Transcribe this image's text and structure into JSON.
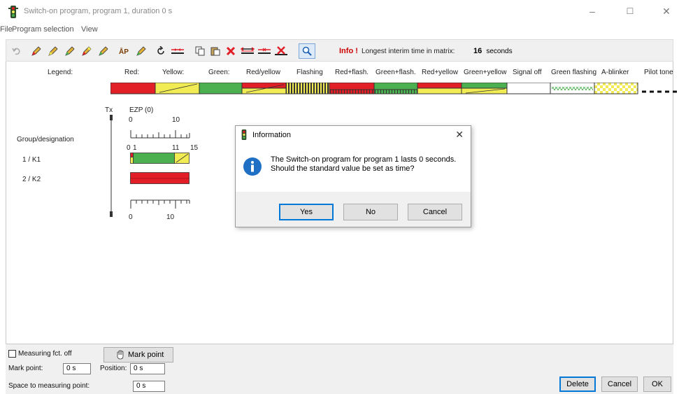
{
  "window": {
    "title": "Switch-on program, program 1, duration 0 s",
    "controls": {
      "minimize": "–",
      "maximize": "☐",
      "close": "✕"
    }
  },
  "menu": [
    "File",
    "Program selection",
    "View"
  ],
  "toolbar": {
    "info_excl": "Info !",
    "info_text": "Longest interim time in matrix:",
    "info_value": "16",
    "info_unit": "seconds"
  },
  "legend": {
    "title": "Legend:",
    "items": [
      {
        "label": "Red:"
      },
      {
        "label": "Yellow:"
      },
      {
        "label": "Green:"
      },
      {
        "label": "Red/yellow"
      },
      {
        "label": "Flashing"
      },
      {
        "label": "Red+flash."
      },
      {
        "label": "Green+flash."
      },
      {
        "label": "Red+yellow"
      },
      {
        "label": "Green+yellow"
      },
      {
        "label": "Signal off"
      },
      {
        "label": "Green flashing"
      },
      {
        "label": "A-blinker"
      },
      {
        "label": "Pilot tone"
      }
    ]
  },
  "diagram": {
    "tx": "Tx",
    "ezp": "EZP (0)",
    "top_ticks": [
      "0",
      "10"
    ],
    "group_header": "Group/designation",
    "k1_ticks": [
      "0",
      "1",
      "11",
      "15"
    ],
    "groups": [
      {
        "name": "1 / K1"
      },
      {
        "name": "2 / K2"
      }
    ],
    "bottom_ticks": [
      "0",
      "10"
    ]
  },
  "dialog": {
    "title": "Information",
    "close": "✕",
    "message_line1": "The Switch-on program for program 1 lasts 0 seconds.",
    "message_line2": "Should the standard value be set as time?",
    "buttons": {
      "yes": "Yes",
      "no": "No",
      "cancel": "Cancel"
    }
  },
  "bottom": {
    "measuring": "Measuring fct. off",
    "mark_point_btn": "Mark point",
    "mark_point_label": "Mark point:",
    "mark_point_value": "0 s",
    "position_label": "Position:",
    "position_value": "0 s",
    "space_label": "Space to measuring point:",
    "space_value": "0 s",
    "delete": "Delete",
    "cancel": "Cancel",
    "ok": "OK"
  },
  "colors": {
    "red": "#e21e26",
    "yellow": "#f2ec54",
    "green": "#4caf50",
    "accent": "#0078d7"
  }
}
